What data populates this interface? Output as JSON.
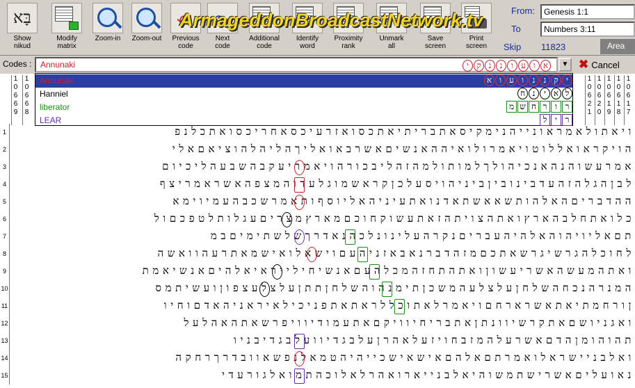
{
  "toolbar": {
    "buttons": [
      {
        "label": "Show\nnikud",
        "icon": "nikud-icon"
      },
      {
        "label": "Modify\nmatrix",
        "icon": "modify-matrix-icon"
      },
      {
        "label": "Zoom-in",
        "icon": "zoom-in-icon"
      },
      {
        "label": "Zoom-out",
        "icon": "zoom-out-icon"
      },
      {
        "label": "Previous\ncode",
        "icon": "previous-code-icon"
      },
      {
        "label": "Next\ncode",
        "icon": "next-code-icon"
      },
      {
        "label": "Additional\ncode",
        "icon": "additional-code-icon"
      },
      {
        "label": "Identify\nword",
        "icon": "identify-word-icon"
      },
      {
        "label": "Proximity\nrank",
        "icon": "proximity-rank-icon"
      },
      {
        "label": "Unmark\nall",
        "icon": "unmark-all-icon"
      },
      {
        "label": "Save\nscreen",
        "icon": "save-screen-icon"
      },
      {
        "label": "Print\nscreen",
        "icon": "print-screen-icon"
      }
    ],
    "nikud_glyph": "בָּא",
    "watermark": "ArmageddonBroadcastNetwork.tv",
    "from_label": "From:",
    "from_value": "Genesis 1:1",
    "to_label": "To",
    "to_value": "Numbers 3:11",
    "skip_label": "Skip",
    "skip_value": "11823",
    "area_label": "Area"
  },
  "codes": {
    "label": "Codes :",
    "value": "Annunaki",
    "hebrew": "יקננועוא",
    "cancel_label": "Cancel"
  },
  "dropdown": {
    "items": [
      {
        "label": "Annunaki",
        "color": "#d02020",
        "hebrew": "יקננועוא"
      },
      {
        "label": "Hanniel",
        "color": "#000000",
        "hebrew": "לאינח"
      },
      {
        "label": "liberator",
        "color": "#1a8a1a",
        "hebrew": "רורחמש"
      },
      {
        "label": "LEAR",
        "color": "#6a2aa8",
        "hebrew": "ריל"
      }
    ]
  },
  "column_headers": {
    "left": [
      "10669",
      "10668"
    ],
    "right": [
      "10621",
      "10620",
      "10619",
      "10618",
      "10617"
    ]
  },
  "matrix_rows": [
    {
      "n": "1",
      "text": "ויאתולאמראונייהנימקיסאתבריתיאתכסואזרעיכסאחריכסואתכלנפ"
    },
    {
      "n": "2",
      "text": "הויקראואללוטויאמרולואיההאנשיםאשרבאואליךהליהלהוציאםאלי"
    },
    {
      "n": "3",
      "text": "אמרעשוהנהאנכיהולךלמותולמהזהליבכורהויאמריעקבהשבעהליכיום"
    },
    {
      "n": "4",
      "text": "לבןהגלהזהעדבינוביןביניהויסעלכןקראשמוגלעדוהמצפהאשראמריצף"
    },
    {
      "n": "5",
      "text": "ההדבריםהאלהותשאאשתאדנואתעיניהאליוסףותאמרשכבהעמיוימא"
    },
    {
      "n": "6",
      "text": "כלואתחלבהארץואתהצויתהזאתעשוקחוכםמארץמצריםעגלותלטפכםול"
    },
    {
      "n": "7",
      "text": "תםאליויהוהאלהיהעבריםנקרהעלינונלכהנאדרךשלשתימיםבמ"
    },
    {
      "n": "8",
      "text": "לחוכלהגרשיגרשאתכםמזהדברנאבאזניהעםוישאלואישמאתרעהוואשה"
    },
    {
      "n": "9",
      "text": "ואתהמעשהאשריעשוןואתהתחזהמכלהעםאנשיחילייראיאלהיםאנשיאמת"
    },
    {
      "n": "10",
      "text": "המנרהנכחהשלחןעלצלעהמשכןתימנהוהשלחןתתןעלצלעצפוןועשיתמס"
    },
    {
      "n": "11",
      "text": "ןורחמתיאתאשרארחםויאמרלאתוכללראתאתפניכילאיראניהאדםוחיו"
    },
    {
      "n": "12",
      "text": "ואגניושםאתקרשיוונתןאתבריחיוויקםאתעמודיוויפרשאתהאהלעל"
    },
    {
      "n": "13",
      "text": "תהוהומןהדםאשרעלהמזבחויזעלאהרןעלבגדיוועלבגדיבניו"
    },
    {
      "n": "14",
      "text": "ואלבניישראלואמרתםאלהםאישאישכייהיהטמאלנפשאוובדרךרחקה"
    },
    {
      "n": "15",
      "text": "נאועליםאשרישתמשוהיאלבנייארואהרלאלוכהתמואלגורעדי"
    }
  ]
}
